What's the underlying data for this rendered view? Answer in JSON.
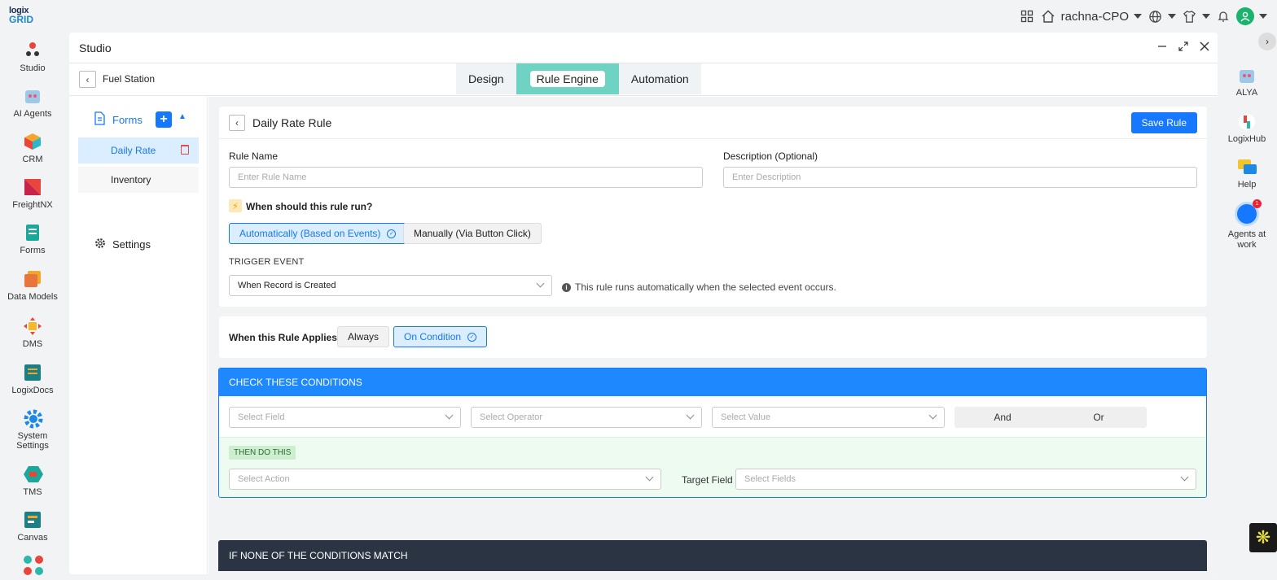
{
  "logo": {
    "line1": "logix",
    "line2": "GRID"
  },
  "topbar": {
    "workspace": "rachna-CPO"
  },
  "apps": [
    {
      "label": "Studio",
      "icon": "studio-icon"
    },
    {
      "label": "AI Agents",
      "icon": "ai-agents-icon"
    },
    {
      "label": "CRM",
      "icon": "crm-icon"
    },
    {
      "label": "FreightNX",
      "icon": "freightnx-icon"
    },
    {
      "label": "Forms",
      "icon": "forms-icon"
    },
    {
      "label": "Data Models",
      "icon": "data-models-icon"
    },
    {
      "label": "DMS",
      "icon": "dms-icon"
    },
    {
      "label": "LogixDocs",
      "icon": "logixdocs-icon"
    },
    {
      "label": "System Settings",
      "icon": "system-settings-icon"
    },
    {
      "label": "TMS",
      "icon": "tms-icon"
    },
    {
      "label": "Canvas",
      "icon": "canvas-icon"
    }
  ],
  "window": {
    "title": "Studio",
    "subtitle": "Fuel Station"
  },
  "tabs": [
    "Design",
    "Rule Engine",
    "Automation"
  ],
  "forms": {
    "header": "Forms",
    "items": [
      "Daily Rate",
      "Inventory"
    ],
    "settings": "Settings"
  },
  "rule": {
    "title": "Daily Rate Rule",
    "save_label": "Save Rule",
    "name_label": "Rule Name",
    "name_placeholder": "Enter Rule Name",
    "desc_label": "Description (Optional)",
    "desc_placeholder": "Enter Description",
    "question": "When should this rule run?",
    "run_auto": "Automatically (Based on Events)",
    "run_manual": "Manually (Via Button Click)",
    "trigger_label": "TRIGGER EVENT",
    "trigger_value": "When Record is Created",
    "trigger_info": "This rule runs automatically when the selected event occurs."
  },
  "applies": {
    "label": "When this Rule Applies",
    "always": "Always",
    "on_condition": "On Condition"
  },
  "conditions": {
    "header": "CHECK THESE CONDITIONS",
    "field_ph": "Select Field",
    "operator_ph": "Select Operator",
    "value_ph": "Select Value",
    "and": "And",
    "or": "Or",
    "then_label": "THEN DO THIS",
    "action_ph": "Select Action",
    "target_label": "Target Field",
    "target_ph": "Select Fields"
  },
  "none_header": "IF NONE OF THE CONDITIONS MATCH",
  "rail": [
    {
      "label": "ALYA"
    },
    {
      "label": "LogixHub"
    },
    {
      "label": "Help"
    },
    {
      "label": "Agents at work",
      "badge": "1"
    }
  ],
  "colors": {
    "accent": "#1677ff",
    "tab_active": "#6ed3c3",
    "dark_header": "#2b3443"
  }
}
